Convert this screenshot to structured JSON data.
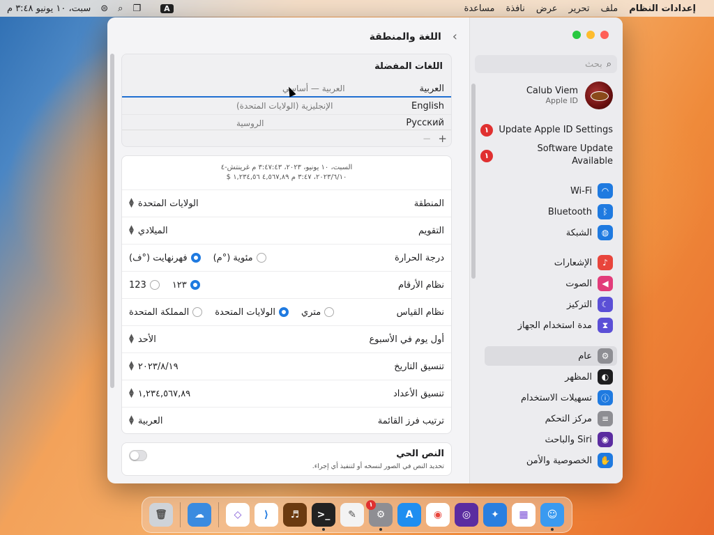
{
  "menubar": {
    "app": "إعدادات النظام",
    "items": [
      "ملف",
      "تحرير",
      "عرض",
      "نافذة",
      "مساعدة"
    ],
    "clock": "سبت، ١٠ يونيو ٣:٤٨ م",
    "input_badge": "A"
  },
  "sidebar": {
    "search_placeholder": "بحث",
    "profile": {
      "name": "Calub Viem",
      "sub": "Apple ID"
    },
    "alerts": [
      {
        "text": "Update Apple ID Settings",
        "badge": "١"
      },
      {
        "text": "Software Update Available",
        "badge": "١"
      }
    ],
    "items": [
      {
        "label": "Wi-Fi",
        "icon": "wifi-icon",
        "color": "#1f7ae0"
      },
      {
        "label": "Bluetooth",
        "icon": "bluetooth-icon",
        "color": "#1f7ae0"
      },
      {
        "label": "الشبكة",
        "icon": "globe-icon",
        "color": "#1f7ae0"
      },
      {
        "label": "الإشعارات",
        "icon": "bell-icon",
        "color": "#e8453c"
      },
      {
        "label": "الصوت",
        "icon": "speaker-icon",
        "color": "#e23c7a"
      },
      {
        "label": "التركيز",
        "icon": "moon-icon",
        "color": "#5b4fd6"
      },
      {
        "label": "مدة استخدام الجهاز",
        "icon": "hourglass-icon",
        "color": "#5b4fd6"
      },
      {
        "label": "عام",
        "icon": "gear-icon",
        "color": "#8e8e93"
      },
      {
        "label": "المظهر",
        "icon": "appearance-icon",
        "color": "#1d1d1f"
      },
      {
        "label": "تسهيلات الاستخدام",
        "icon": "accessibility-icon",
        "color": "#1f7ae0"
      },
      {
        "label": "مركز التحكم",
        "icon": "control-center-icon",
        "color": "#8e8e93"
      },
      {
        "label": "Siri والباحث",
        "icon": "siri-icon",
        "color": "#5b2ca0"
      },
      {
        "label": "الخصوصية والأمن",
        "icon": "hand-icon",
        "color": "#1f7ae0"
      }
    ]
  },
  "main": {
    "title": "اللغة والمنطقة",
    "preferred_title": "اللغات المفضلة",
    "languages": [
      {
        "name": "العربية",
        "sub": "العربية — أساسي"
      },
      {
        "name": "English",
        "sub": "الإنجليزية (الولايات المتحدة)"
      },
      {
        "name": "Русский",
        "sub": "الروسية"
      }
    ],
    "drag_overlay": {
      "name": "Русский",
      "sub": "الروسية"
    },
    "plus": "+",
    "minus": "−",
    "preview_line1": "السبت، ١٠ يونيو، ٢٠٢٣، ٣:٤٧:٤٣ م غرينتش-٤",
    "preview_line2": "٢٠٢٣/٦/١٠، ٣:٤٧ م     ٤,٥٦٧,٨٩     ١,٢٣٤,٥٦ $",
    "rows": {
      "region": {
        "label": "المنطقة",
        "value": "الولايات المتحدة"
      },
      "calendar": {
        "label": "التقويم",
        "value": "الميلادي"
      },
      "temperature": {
        "label": "درجة الحرارة",
        "opt1": "مئوية (°م)",
        "opt2": "فهرنهايت (°ف)"
      },
      "numbers": {
        "label": "نظام الأرقام",
        "opt1": "١٢٣",
        "opt2": "123"
      },
      "measure": {
        "label": "نظام القياس",
        "opt1": "متري",
        "opt2": "الولايات المتحدة",
        "opt3": "المملكة المتحدة"
      },
      "first_day": {
        "label": "أول يوم في الأسبوع",
        "value": "الأحد"
      },
      "date_format": {
        "label": "تنسيق التاريخ",
        "value": "٢٠٢٣/٨/١٩"
      },
      "number_format": {
        "label": "تنسيق الأعداد",
        "value": "١,٢٣٤,٥٦٧,٨٩"
      },
      "list_sort": {
        "label": "ترتيب فرز القائمة",
        "value": "العربية"
      }
    },
    "live_text": {
      "title": "النص الحي",
      "desc": "تحديد النص في الصور لنسخه أو لتنفيذ أي إجراء."
    }
  },
  "dock": {
    "apps": [
      "trash",
      "weather",
      "visual-studio",
      "vscode",
      "instruments",
      "terminal",
      "textedit",
      "system-settings",
      "app-store",
      "chrome",
      "firefox",
      "safari",
      "launchpad",
      "finder"
    ],
    "settings_badge": "١"
  }
}
